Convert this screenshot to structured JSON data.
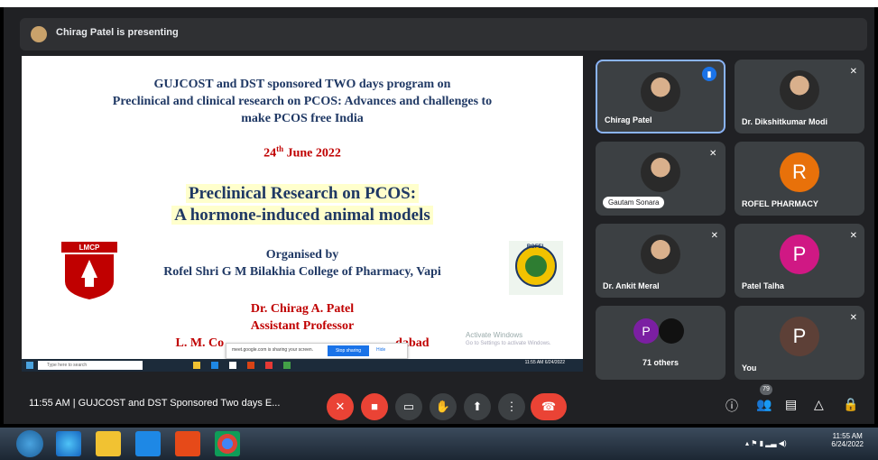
{
  "presenter_bar": {
    "text": "Chirag Patel is presenting"
  },
  "slide": {
    "headline": [
      "GUJCOST and DST sponsored TWO days program on",
      "Preclinical and clinical research on PCOS: Advances and challenges to",
      "make PCOS free India"
    ],
    "date_day": "24",
    "date_suffix": "th",
    "date_rest": " June 2022",
    "title": [
      "Preclinical Research on PCOS:",
      "A hormone-induced animal models"
    ],
    "organised_by": "Organised by",
    "college": "Rofel Shri G M Bilakhia College of Pharmacy, Vapi",
    "speaker_name": "Dr. Chirag A. Patel",
    "speaker_role": "Assistant Professor",
    "speaker_inst_left": "L. M. Co",
    "speaker_inst_right": "dabad",
    "left_logo_text": "LMCP",
    "right_logo_text": "ROFEL",
    "activate_line1": "Activate Windows",
    "activate_line2": "Go to Settings to activate Windows.",
    "share_msg": "meet.google.com is sharing your screen.",
    "share_stop": "Stop sharing",
    "share_hide": "Hide",
    "inner_search": "Type here to search",
    "inner_time": "11:55 AM",
    "inner_date": "6/24/2022"
  },
  "tiles": [
    {
      "name": "Chirag Patel"
    },
    {
      "name": "Dr. Dikshitkumar Modi"
    },
    {
      "name": "Gautam Sonara"
    },
    {
      "name": "ROFEL PHARMACY",
      "initial": "R",
      "color": "#e8710a"
    },
    {
      "name": "Dr. Ankit Meral"
    },
    {
      "name": "Patel Talha",
      "initial": "P",
      "color": "#d01884"
    },
    {
      "name": "71 others",
      "initial": "P",
      "color": "#7b1fa2"
    },
    {
      "name": "You",
      "initial": "P",
      "color": "#5d4037"
    }
  ],
  "controls": {
    "time_title": "11:55 AM  |  GUJCOST and DST Sponsored Two days E...",
    "people_count": "79"
  },
  "os": {
    "time": "11:55 AM",
    "date": "6/24/2022"
  }
}
